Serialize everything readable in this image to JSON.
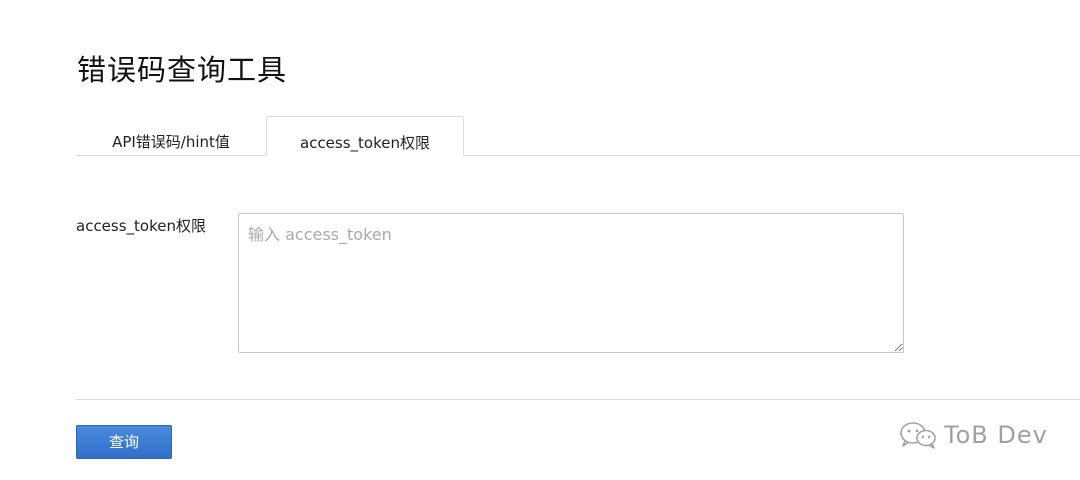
{
  "page": {
    "title": "错误码查询工具"
  },
  "tabs": [
    {
      "label": "API错误码/hint值",
      "active": false
    },
    {
      "label": "access_token权限",
      "active": true
    }
  ],
  "form": {
    "field_label": "access_token权限",
    "textarea_value": "",
    "textarea_placeholder": "输入 access_token",
    "submit_label": "查询"
  },
  "watermark": {
    "icon": "wechat-icon",
    "text": "ToB Dev"
  },
  "colors": {
    "button_bg": "#3a7bd5",
    "border": "#dcdcdc",
    "placeholder": "#a9a9a9"
  }
}
